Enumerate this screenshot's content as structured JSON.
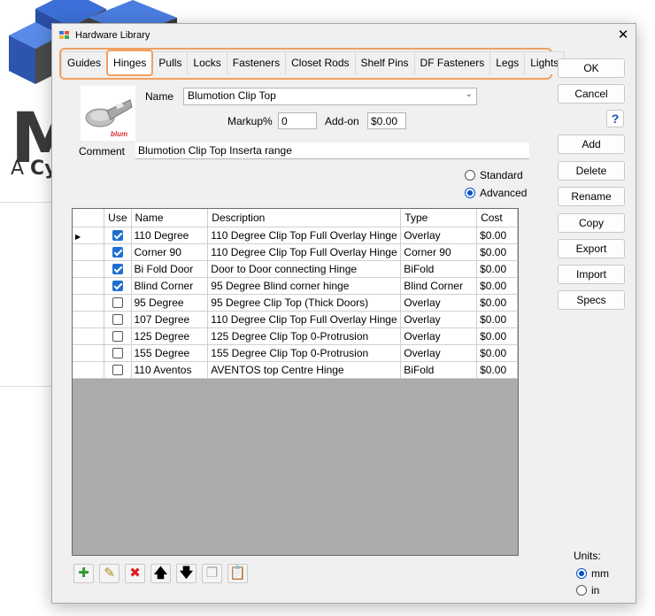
{
  "window": {
    "title": "Hardware Library",
    "close": "✕"
  },
  "tabs": [
    "Guides",
    "Hinges",
    "Pulls",
    "Locks",
    "Fasteners",
    "Closet Rods",
    "Shelf Pins",
    "DF Fasteners",
    "Legs",
    "Lights"
  ],
  "active_tab": "Hinges",
  "form": {
    "name_label": "Name",
    "name_value": "Blumotion Clip Top",
    "markup_label": "Markup%",
    "markup_value": "0",
    "addon_label": "Add-on",
    "addon_value": "$0.00",
    "comment_label": "Comment",
    "comment_value": "Blumotion Clip Top Inserta range",
    "brand_logo": "blum"
  },
  "mode": {
    "standard_label": "Standard",
    "advanced_label": "Advanced",
    "selected": "Advanced"
  },
  "grid": {
    "columns": [
      "Use",
      "Name",
      "Description",
      "Type",
      "Cost"
    ],
    "rows": [
      {
        "use": true,
        "name": "110 Degree",
        "description": "110 Degree Clip Top Full Overlay Hinge",
        "type": "Overlay",
        "cost": "$0.00"
      },
      {
        "use": true,
        "name": "Corner 90",
        "description": "110 Degree Clip Top Full Overlay Hinge",
        "type": "Corner 90",
        "cost": "$0.00"
      },
      {
        "use": true,
        "name": "Bi Fold Door",
        "description": "Door to Door connecting Hinge",
        "type": "BiFold",
        "cost": "$0.00"
      },
      {
        "use": true,
        "name": "Blind Corner",
        "description": "95 Degree Blind corner hinge",
        "type": "Blind Corner",
        "cost": "$0.00"
      },
      {
        "use": false,
        "name": "95 Degree",
        "description": "95 Degree Clip Top (Thick Doors)",
        "type": "Overlay",
        "cost": "$0.00"
      },
      {
        "use": false,
        "name": "107 Degree",
        "description": "110 Degree Clip Top Full Overlay Hinge",
        "type": "Overlay",
        "cost": "$0.00"
      },
      {
        "use": false,
        "name": "125 Degree",
        "description": "125 Degree Clip Top 0-Protrusion",
        "type": "Overlay",
        "cost": "$0.00"
      },
      {
        "use": false,
        "name": "155 Degree",
        "description": "155 Degree Clip Top 0-Protrusion",
        "type": "Overlay",
        "cost": "$0.00"
      },
      {
        "use": false,
        "name": "110 Aventos",
        "description": "AVENTOS top Centre Hinge",
        "type": "BiFold",
        "cost": "$0.00"
      }
    ]
  },
  "buttons": {
    "ok": "OK",
    "cancel": "Cancel",
    "help": "?",
    "add": "Add",
    "delete": "Delete",
    "rename": "Rename",
    "copy": "Copy",
    "export": "Export",
    "import": "Import",
    "specs": "Specs"
  },
  "toolbar_icons": [
    "add-icon",
    "edit-icon",
    "delete-icon",
    "move-up-icon",
    "move-down-icon",
    "copy-icon",
    "paste-icon"
  ],
  "units": {
    "label": "Units:",
    "mm_label": "mm",
    "in_label": "in",
    "selected": "mm"
  },
  "background": {
    "letter": "M",
    "tagline_prefix": "A ",
    "tagline_bold": "Cy"
  },
  "colors": {
    "accent": "#f0a060",
    "check": "#1f6fd1",
    "grid_empty": "#ababab"
  }
}
